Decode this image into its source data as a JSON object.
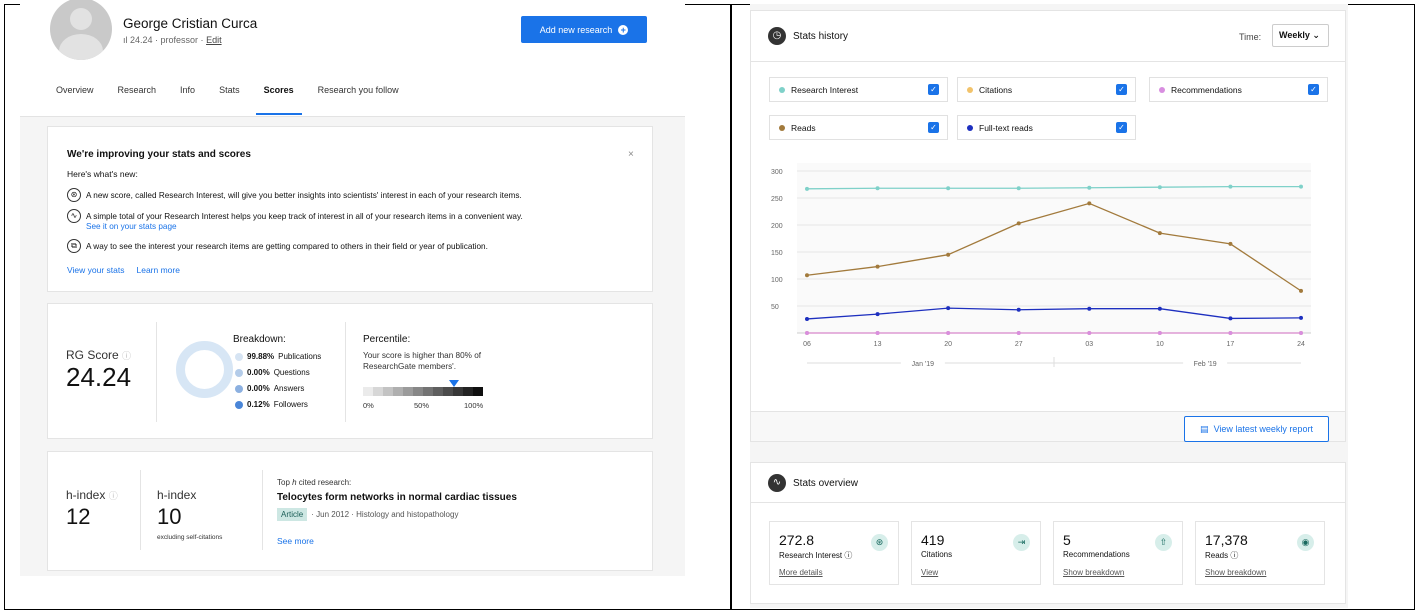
{
  "profile": {
    "name": "George Cristian Curca",
    "score_line": "24.24 · professor · ",
    "edit_label": "Edit",
    "add_button": "Add new research"
  },
  "tabs": [
    {
      "label": "Overview"
    },
    {
      "label": "Research"
    },
    {
      "label": "Info"
    },
    {
      "label": "Stats"
    },
    {
      "label": "Scores",
      "active": true
    },
    {
      "label": "Research you follow"
    }
  ],
  "improving": {
    "title": "We're improving your stats and scores",
    "heres_whats_new": "Here's what's new:",
    "items": [
      {
        "text": "A new score, called Research Interest, will give you better insights into scientists' interest in each of your research items.",
        "link": ""
      },
      {
        "text": "A simple total of your Research Interest helps you keep track of interest in all of your research items in a convenient way.",
        "link": "See it on your stats page"
      },
      {
        "text": "A way to see the interest your research items are getting compared to others in their field or year of publication.",
        "link": ""
      }
    ],
    "view_stats": "View your stats",
    "learn_more": "Learn more"
  },
  "rg_score": {
    "label": "RG Score",
    "value": "24.24",
    "breakdown_title": "Breakdown:",
    "breakdown": [
      {
        "pct": "99.88%",
        "label": "Publications",
        "color": "#d6e4f3"
      },
      {
        "pct": "0.00%",
        "label": "Questions",
        "color": "#b4cce9"
      },
      {
        "pct": "0.00%",
        "label": "Answers",
        "color": "#8cb0e0"
      },
      {
        "pct": "0.12%",
        "label": "Followers",
        "color": "#4a86d8"
      }
    ],
    "percentile_title": "Percentile:",
    "percentile_text": "Your score is higher than 80% of ResearchGate members'.",
    "percentile_value": 80,
    "ticks": [
      "0%",
      "50%",
      "100%"
    ]
  },
  "hindex": {
    "label": "h-index",
    "value": "12",
    "label2": "h-index",
    "value2": "10",
    "sub2": "excluding self-citations",
    "top_title_pre": "Top ",
    "top_title_h": "h",
    "top_title_post": " cited research:",
    "paper_title": "Telocytes form networks in normal cardiac tissues",
    "paper_type": "Article",
    "paper_meta": "· Jun 2012 · Histology and histopathology",
    "see_more": "See more"
  },
  "stats_history": {
    "title": "Stats history",
    "time_label": "Time:",
    "time_value": "Weekly",
    "legend": [
      {
        "label": "Research Interest",
        "color": "#7fd1c9"
      },
      {
        "label": "Citations",
        "color": "#f2c36b"
      },
      {
        "label": "Recommendations",
        "color": "#d88ee0"
      },
      {
        "label": "Reads",
        "color": "#a27a3c"
      },
      {
        "label": "Full-text reads",
        "color": "#1d2fbf"
      }
    ],
    "report_button": "View latest weekly report"
  },
  "chart_data": {
    "type": "line",
    "x": [
      "06",
      "13",
      "20",
      "27",
      "03",
      "10",
      "17",
      "24"
    ],
    "month_labels": [
      "Jan '19",
      "Feb '19"
    ],
    "ylim": [
      0,
      300
    ],
    "yticks": [
      50,
      100,
      150,
      200,
      250,
      300
    ],
    "series": [
      {
        "name": "Research Interest",
        "color": "#7fd1c9",
        "values": [
          267,
          268,
          268,
          268,
          269,
          270,
          271,
          271
        ]
      },
      {
        "name": "Citations",
        "color": "#f2c36b",
        "values": [
          0,
          0,
          0,
          0,
          0,
          0,
          0,
          0
        ]
      },
      {
        "name": "Recommendations",
        "color": "#d88ee0",
        "values": [
          0,
          0,
          0,
          0,
          0,
          0,
          0,
          0
        ]
      },
      {
        "name": "Reads",
        "color": "#a27a3c",
        "values": [
          107,
          123,
          145,
          203,
          240,
          185,
          165,
          78
        ]
      },
      {
        "name": "Full-text reads",
        "color": "#1d2fbf",
        "values": [
          26,
          35,
          46,
          43,
          45,
          45,
          27,
          28
        ]
      }
    ]
  },
  "stats_overview": {
    "title": "Stats overview",
    "tiles": [
      {
        "value": "272.8",
        "label": "Research Interest ⓘ",
        "action": "More details"
      },
      {
        "value": "419",
        "label": "Citations",
        "action": "View"
      },
      {
        "value": "5",
        "label": "Recommendations",
        "action": "Show breakdown"
      },
      {
        "value": "17,378",
        "label": "Reads ⓘ",
        "action": "Show breakdown"
      }
    ]
  }
}
